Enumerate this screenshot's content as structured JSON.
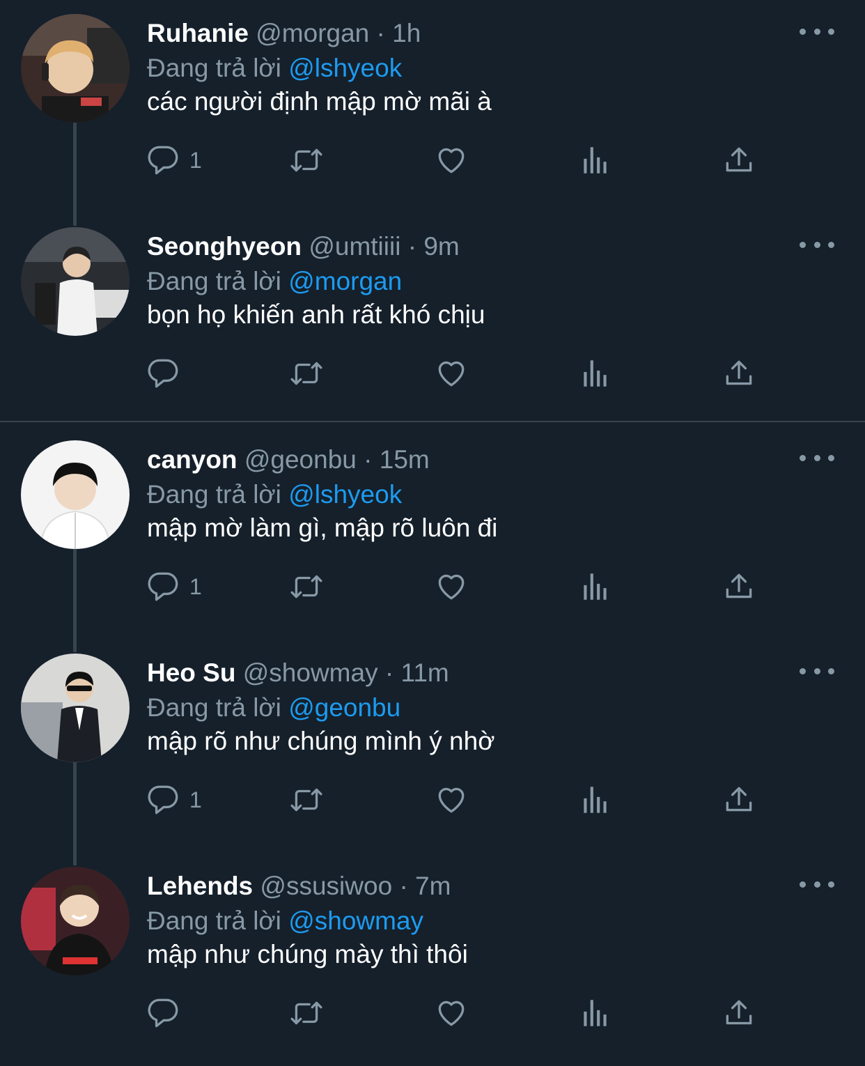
{
  "colors": {
    "background": "#15202b",
    "mention": "#1d9bf0",
    "secondary": "#8899a6"
  },
  "icons": {
    "reply": "reply-icon",
    "retweet": "retweet-icon",
    "like": "heart-icon",
    "stats": "stats-icon",
    "share": "share-icon",
    "more": "more-icon"
  },
  "tweets": [
    {
      "name": "Ruhanie",
      "handle": "@morgan",
      "sep": "·",
      "time": "1h",
      "replying_prefix": "Đang trả lời",
      "replying_to": "@lshyeok",
      "text": "các người định mập mờ mãi à",
      "reply_count": "1"
    },
    {
      "name": "Seonghyeon",
      "handle": "@umtiiii",
      "sep": "·",
      "time": "9m",
      "replying_prefix": "Đang trả lời",
      "replying_to": "@morgan",
      "text": "bọn họ khiến anh rất khó chịu",
      "reply_count": ""
    },
    {
      "name": "canyon",
      "handle": "@geonbu",
      "sep": "·",
      "time": "15m",
      "replying_prefix": "Đang trả lời",
      "replying_to": "@lshyeok",
      "text": "mập mờ làm gì, mập rõ luôn đi",
      "reply_count": "1"
    },
    {
      "name": "Heo Su",
      "handle": "@showmay",
      "sep": "·",
      "time": "11m",
      "replying_prefix": "Đang trả lời",
      "replying_to": "@geonbu",
      "text": "mập rõ như chúng mình ý nhờ",
      "reply_count": "1"
    },
    {
      "name": "Lehends",
      "handle": "@ssusiwoo",
      "sep": "·",
      "time": "7m",
      "replying_prefix": "Đang trả lời",
      "replying_to": "@showmay",
      "text": "mập như chúng mày thì thôi",
      "reply_count": ""
    }
  ]
}
